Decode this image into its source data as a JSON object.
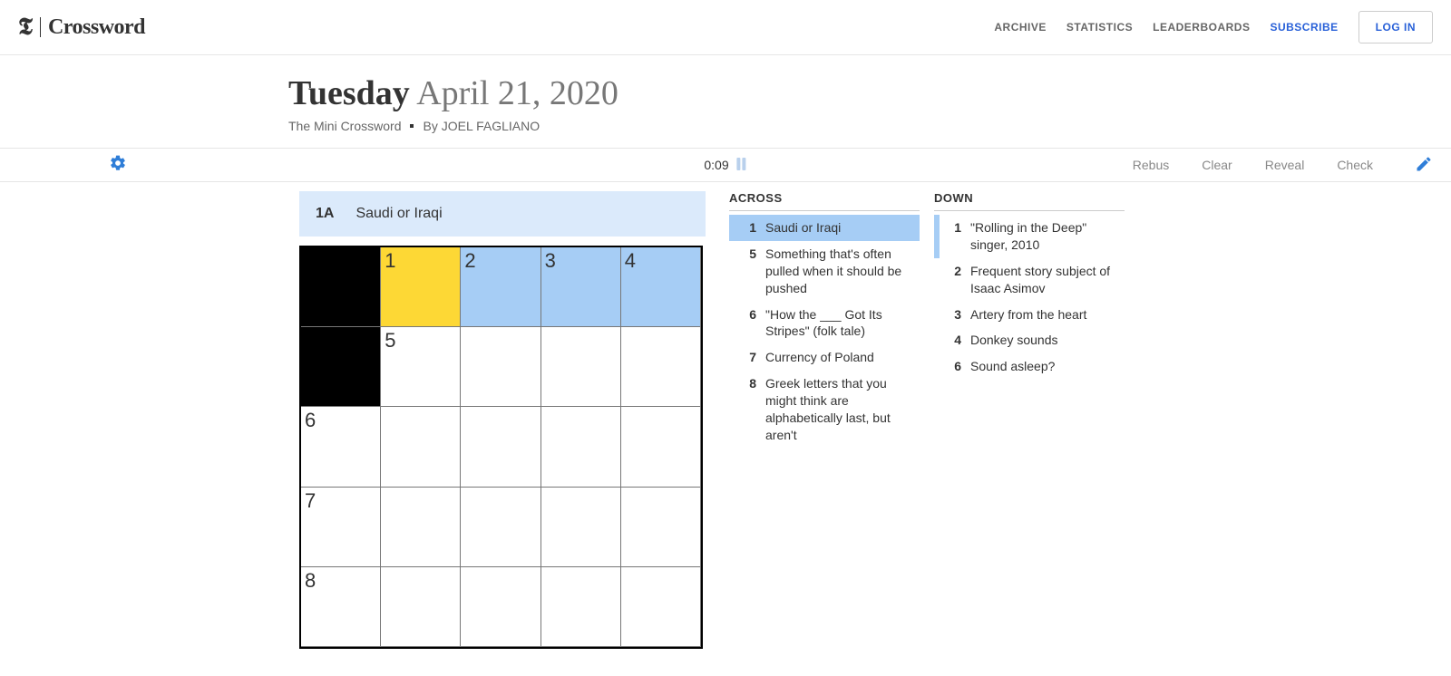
{
  "brand": {
    "t": "𝕿",
    "word": "Crossword"
  },
  "nav": {
    "archive": "ARCHIVE",
    "statistics": "STATISTICS",
    "leaderboards": "LEADERBOARDS",
    "subscribe": "SUBSCRIBE",
    "login": "LOG IN"
  },
  "title": {
    "day": "Tuesday",
    "date": "April 21, 2020",
    "puzzle_name": "The Mini Crossword",
    "by_prefix": "By ",
    "author": "JOEL FAGLIANO"
  },
  "toolbar": {
    "timer": "0:09",
    "rebus": "Rebus",
    "clear": "Clear",
    "reveal": "Reveal",
    "check": "Check"
  },
  "current_clue": {
    "label": "1A",
    "text": "Saudi or Iraqi"
  },
  "grid": {
    "size": 5,
    "cells": [
      {
        "r": 0,
        "c": 0,
        "black": true
      },
      {
        "r": 0,
        "c": 1,
        "num": "1",
        "cur": true
      },
      {
        "r": 0,
        "c": 2,
        "num": "2",
        "sel": true
      },
      {
        "r": 0,
        "c": 3,
        "num": "3",
        "sel": true
      },
      {
        "r": 0,
        "c": 4,
        "num": "4",
        "sel": true
      },
      {
        "r": 1,
        "c": 0,
        "black": true
      },
      {
        "r": 1,
        "c": 1,
        "num": "5"
      },
      {
        "r": 1,
        "c": 2
      },
      {
        "r": 1,
        "c": 3
      },
      {
        "r": 1,
        "c": 4
      },
      {
        "r": 2,
        "c": 0,
        "num": "6"
      },
      {
        "r": 2,
        "c": 1
      },
      {
        "r": 2,
        "c": 2
      },
      {
        "r": 2,
        "c": 3
      },
      {
        "r": 2,
        "c": 4
      },
      {
        "r": 3,
        "c": 0,
        "num": "7"
      },
      {
        "r": 3,
        "c": 1
      },
      {
        "r": 3,
        "c": 2
      },
      {
        "r": 3,
        "c": 3
      },
      {
        "r": 3,
        "c": 4
      },
      {
        "r": 4,
        "c": 0,
        "num": "8"
      },
      {
        "r": 4,
        "c": 1
      },
      {
        "r": 4,
        "c": 2
      },
      {
        "r": 4,
        "c": 3
      },
      {
        "r": 4,
        "c": 4
      }
    ]
  },
  "clues": {
    "across_header": "ACROSS",
    "down_header": "DOWN",
    "across": [
      {
        "n": "1",
        "t": "Saudi or Iraqi",
        "active": true
      },
      {
        "n": "5",
        "t": "Something that's often pulled when it should be pushed"
      },
      {
        "n": "6",
        "t": "\"How the ___ Got Its Stripes\" (folk tale)"
      },
      {
        "n": "7",
        "t": "Currency of Poland"
      },
      {
        "n": "8",
        "t": "Greek letters that you might think are alphabetically last, but aren't"
      }
    ],
    "down": [
      {
        "n": "1",
        "t": "\"Rolling in the Deep\" singer, 2010",
        "related": true
      },
      {
        "n": "2",
        "t": "Frequent story subject of Isaac Asimov"
      },
      {
        "n": "3",
        "t": "Artery from the heart"
      },
      {
        "n": "4",
        "t": "Donkey sounds"
      },
      {
        "n": "6",
        "t": "Sound asleep?"
      }
    ]
  }
}
